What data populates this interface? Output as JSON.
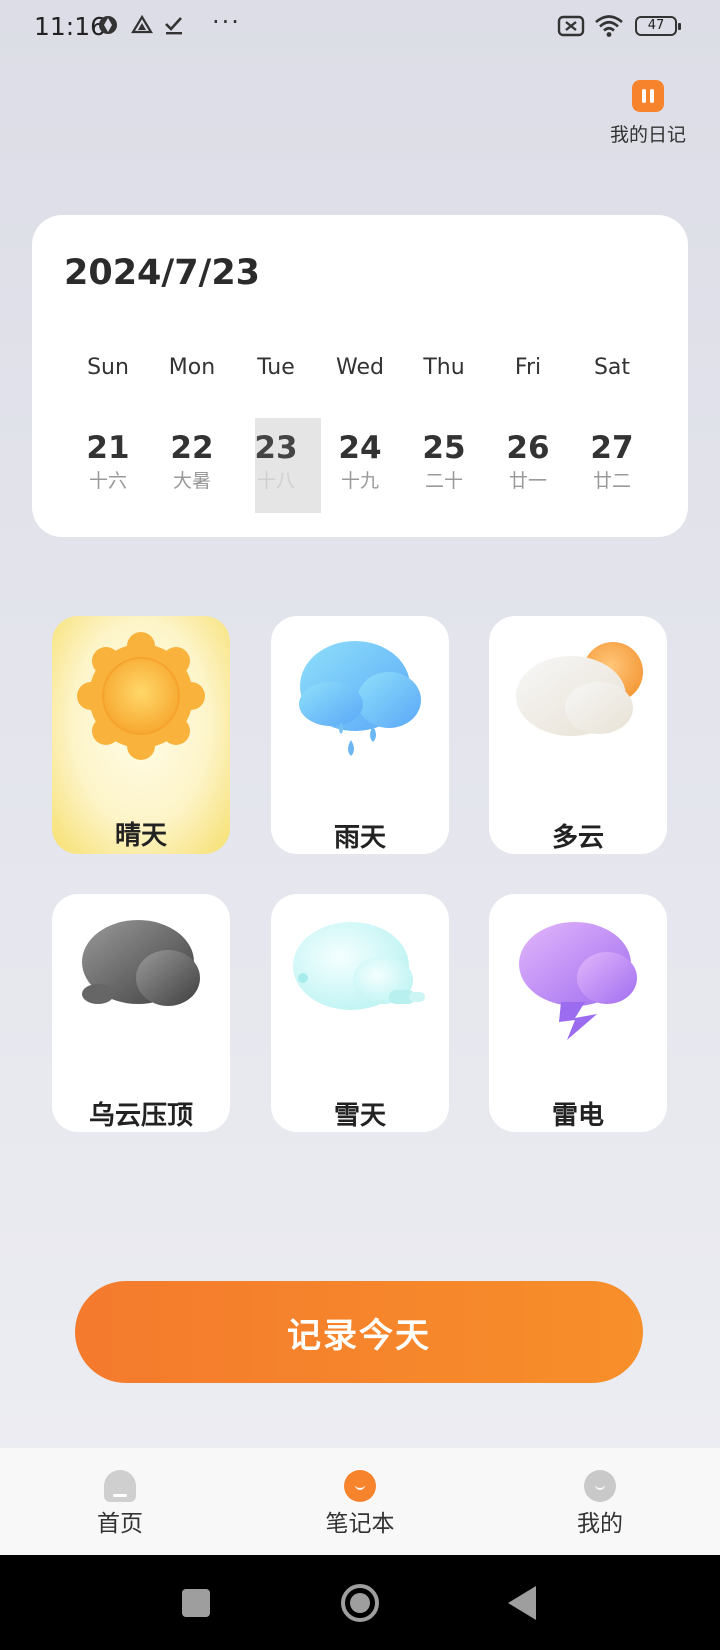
{
  "status_bar": {
    "time": "11:16",
    "battery": "47",
    "more": "···"
  },
  "diary": {
    "label": "我的日记"
  },
  "calendar": {
    "date": "2024/7/23",
    "weekdays": [
      "Sun",
      "Mon",
      "Tue",
      "Wed",
      "Thu",
      "Fri",
      "Sat"
    ],
    "days": [
      {
        "num": "21",
        "lunar": "十六"
      },
      {
        "num": "22",
        "lunar": "大暑"
      },
      {
        "num": "23",
        "lunar": "十八"
      },
      {
        "num": "24",
        "lunar": "十九"
      },
      {
        "num": "25",
        "lunar": "二十"
      },
      {
        "num": "26",
        "lunar": "廿一"
      },
      {
        "num": "27",
        "lunar": "廿二"
      }
    ]
  },
  "weather": [
    {
      "label": "晴天",
      "icon": "sun-icon"
    },
    {
      "label": "雨天",
      "icon": "rain-cloud-icon"
    },
    {
      "label": "多云",
      "icon": "partly-cloudy-icon"
    },
    {
      "label": "乌云压顶",
      "icon": "dark-cloud-icon"
    },
    {
      "label": "雪天",
      "icon": "snow-cloud-icon"
    },
    {
      "label": "雷电",
      "icon": "thunder-cloud-icon"
    }
  ],
  "record_button": "记录今天",
  "nav": {
    "home": "首页",
    "notebook": "笔记本",
    "mine": "我的"
  },
  "colors": {
    "accent": "#F7842C",
    "selected_weather": "#F6DF6E"
  }
}
